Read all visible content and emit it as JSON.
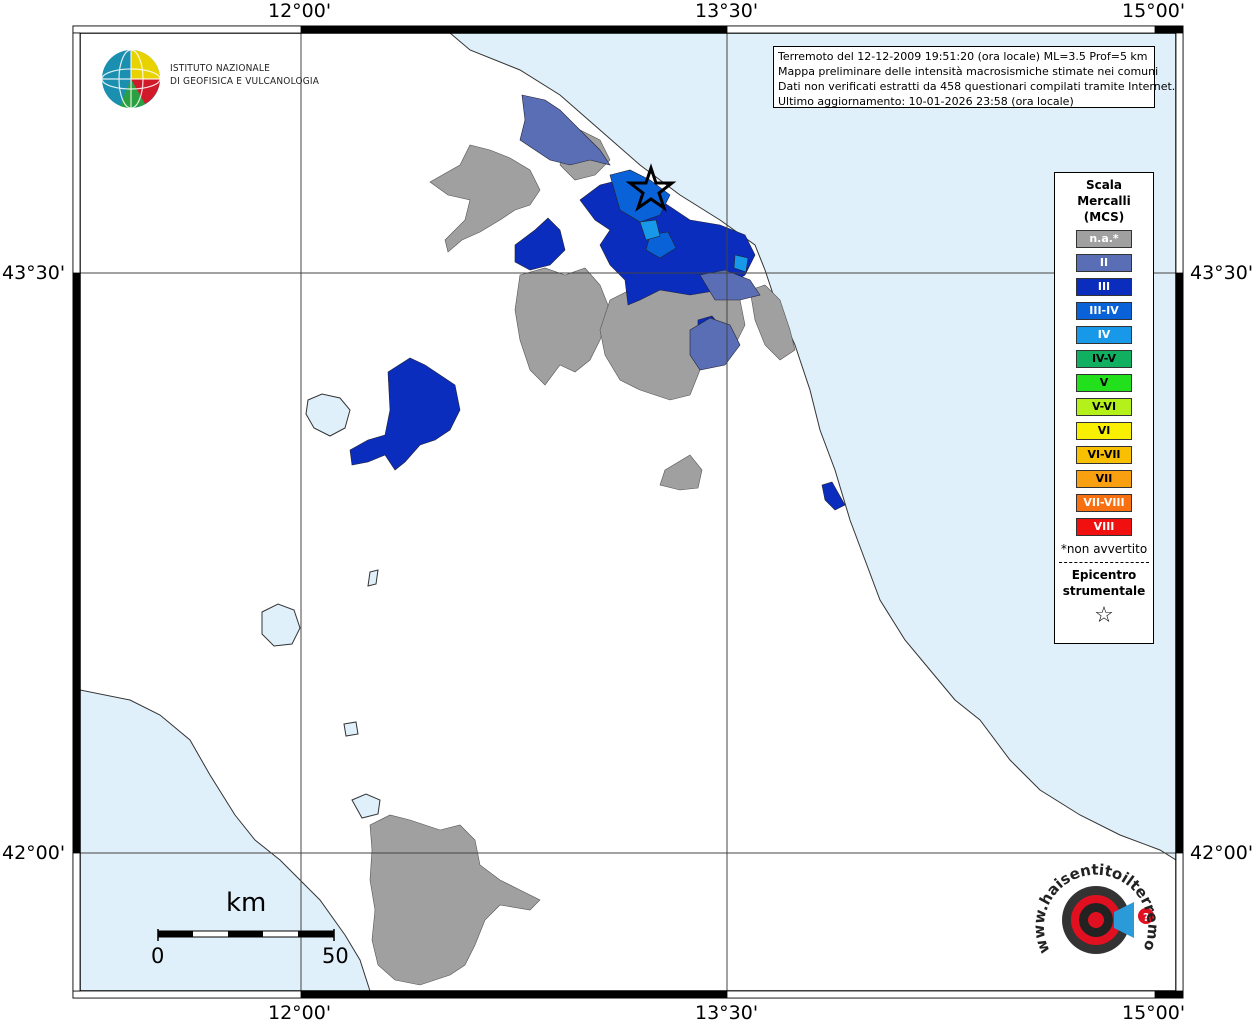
{
  "map": {
    "ticks": {
      "top": [
        "12°00'",
        "13°30'",
        "15°00'"
      ],
      "bottom": [
        "12°00'",
        "13°30'",
        "15°00'"
      ],
      "left": [
        "43°30'",
        "42°00'"
      ],
      "right": [
        "43°30'",
        "42°00'"
      ]
    },
    "colors": {
      "sea": "#dff0fa",
      "land": "#ffffff",
      "na": "#a0a0a0",
      "ii": "#5a6eb5",
      "iii": "#0a2dbe",
      "iii_iv": "#0a62d9",
      "iv": "#1898e8"
    }
  },
  "info": {
    "line1": "Terremoto del 12-12-2009 19:51:20 (ora locale) ML=3.5 Prof=5 km",
    "line2": "Mappa preliminare delle intensità macrosismiche stimate nei comuni",
    "line3": "Dati non verificati estratti da 458 questionari compilati tramite Internet.",
    "line4": "Ultimo aggiornamento: 10-01-2026 23:58 (ora locale)"
  },
  "logo": {
    "line1": "ISTITUTO NAZIONALE",
    "line2": "DI GEOFISICA E VULCANOLOGIA"
  },
  "legend": {
    "title1": "Scala",
    "title2": "Mercalli",
    "title3": "(MCS)",
    "items": [
      {
        "label": "n.a.*",
        "color": "#a0a0a0"
      },
      {
        "label": "II",
        "color": "#5a6eb5"
      },
      {
        "label": "III",
        "color": "#0a2dbe"
      },
      {
        "label": "III-IV",
        "color": "#0a62d9"
      },
      {
        "label": "IV",
        "color": "#1898e8"
      },
      {
        "label": "IV-V",
        "color": "#10b060"
      },
      {
        "label": "V",
        "color": "#22e01c"
      },
      {
        "label": "V-VI",
        "color": "#b4f01a"
      },
      {
        "label": "VI",
        "color": "#f8f000"
      },
      {
        "label": "VI-VII",
        "color": "#f8c000"
      },
      {
        "label": "VII",
        "color": "#f8a010"
      },
      {
        "label": "VII-VIII",
        "color": "#f87010"
      },
      {
        "label": "VIII",
        "color": "#f01010"
      }
    ],
    "note": "*non avvertito",
    "epi1": "Epicentro",
    "epi2": "strumentale",
    "star": "☆"
  },
  "scalebar": {
    "unit": "km",
    "min": "0",
    "max": "50"
  },
  "site_logo": {
    "text": "www.haisentitoilterremoto.it"
  }
}
